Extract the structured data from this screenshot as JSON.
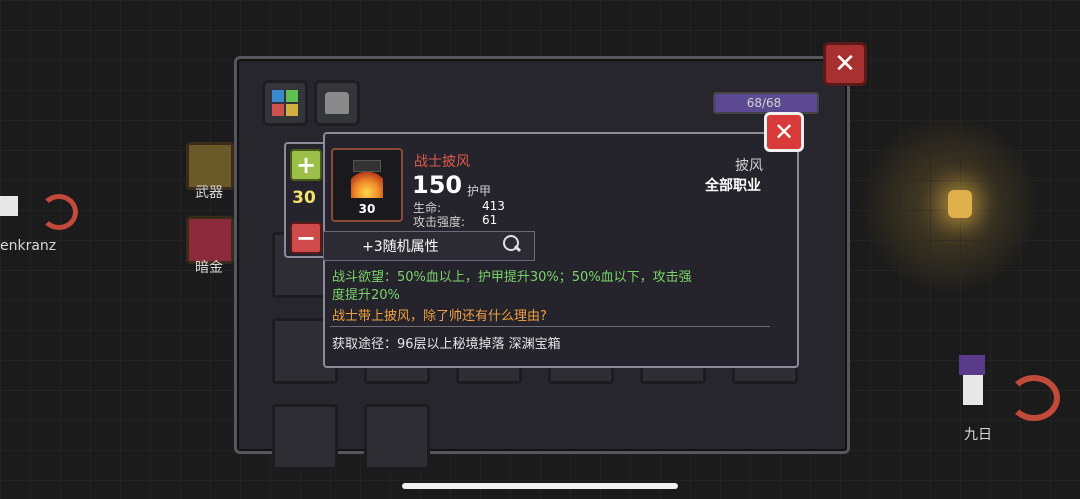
{
  "background": {
    "left_player_name": "enkranz",
    "right_player_name": "九日",
    "side_tabs": [
      {
        "label": "武器",
        "icon": "weapon-tab-icon"
      },
      {
        "label": "暗金",
        "icon": "dark-gold-tab-icon"
      }
    ]
  },
  "panel": {
    "tabs": [
      {
        "icon": "color-grid-icon"
      },
      {
        "icon": "horned-helmet-icon"
      }
    ],
    "hp_text": "68/68",
    "hp_ratio": 1.0,
    "close_label": "✕"
  },
  "tooltip": {
    "item_name": "战士披风",
    "item_level": "30",
    "armor_value": "150",
    "armor_label": "护甲",
    "stats": [
      {
        "label": "生命:",
        "value": "413"
      },
      {
        "label": "攻击强度:",
        "value": "61"
      }
    ],
    "category": "披风",
    "class_restriction": "全部职业",
    "random_attr": "+3随机属性",
    "effect_text_line1": "战斗欲望：50%血以上，护甲提升30%；50%血以下，攻击强",
    "effect_text_line2": "度提升20%",
    "flavor_text": "战士带上披风，除了帅还有什么理由?",
    "source_text": "获取途径：96层以上秘境掉落 深渊宝箱",
    "close_label": "✕"
  },
  "quantity": {
    "plus_label": "+",
    "value": "30",
    "minus_label": "−"
  },
  "colors": {
    "item_name": "#e05a4a",
    "effect_text": "#7ad36a",
    "flavor_text": "#f0a040",
    "quantity_value": "#f2e26a",
    "close_red": "#d83a3a",
    "plus_green": "#9cbf4a",
    "minus_red": "#cf4a4a"
  }
}
